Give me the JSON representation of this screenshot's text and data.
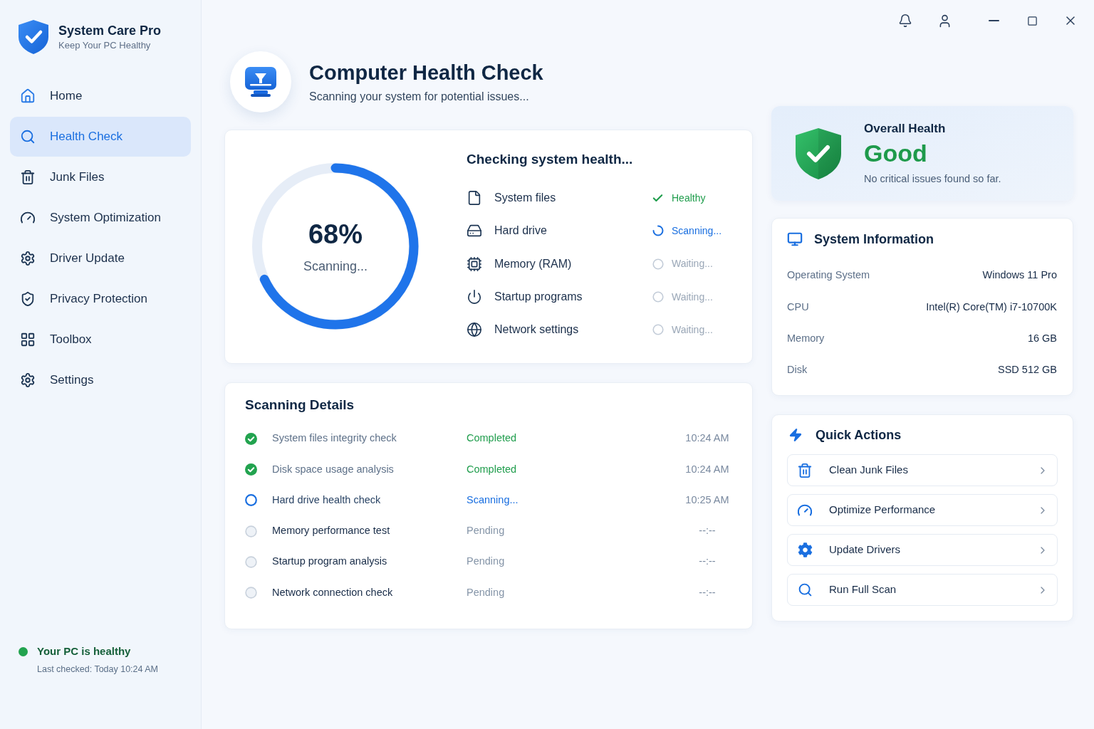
{
  "app": {
    "name": "System Care Pro",
    "tagline": "Keep Your PC Healthy"
  },
  "sidebar": {
    "items": [
      {
        "label": "Home",
        "selected": false
      },
      {
        "label": "Health Check",
        "selected": true
      },
      {
        "label": "Junk Files",
        "selected": false
      },
      {
        "label": "System Optimization",
        "selected": false
      },
      {
        "label": "Driver Update",
        "selected": false
      },
      {
        "label": "Privacy Protection",
        "selected": false
      },
      {
        "label": "Toolbox",
        "selected": false
      },
      {
        "label": "Settings",
        "selected": false
      }
    ],
    "status": {
      "title": "Your PC is healthy",
      "detail": "Last checked: Today 10:24 AM"
    }
  },
  "header": {
    "title": "Computer Health Check",
    "subtitle": "Scanning your system for potential issues..."
  },
  "scan_progress": {
    "level": 0.68,
    "percent": "68%",
    "label": "Scanning..."
  },
  "health_checks": {
    "title": "Checking system health...",
    "items": [
      {
        "label": "System files",
        "status": "Healthy",
        "kind": "done"
      },
      {
        "label": "Hard drive",
        "status": "Scanning...",
        "kind": "scanning"
      },
      {
        "label": "Memory (RAM)",
        "status": "Waiting...",
        "kind": "waiting"
      },
      {
        "label": "Startup programs",
        "status": "Waiting...",
        "kind": "waiting"
      },
      {
        "label": "Network settings",
        "status": "Waiting...",
        "kind": "waiting"
      }
    ]
  },
  "scanning_details": {
    "title": "Scanning Details",
    "rows": [
      {
        "task": "System files integrity check",
        "status": "Completed",
        "time": "10:24 AM",
        "kind": "done"
      },
      {
        "task": "Disk space usage analysis",
        "status": "Completed",
        "time": "10:24 AM",
        "kind": "done"
      },
      {
        "task": "Hard drive health check",
        "status": "Scanning...",
        "time": "10:25 AM",
        "kind": "scanning"
      },
      {
        "task": "Memory performance test",
        "status": "Pending",
        "time": "--:--",
        "kind": "pending"
      },
      {
        "task": "Startup program analysis",
        "status": "Pending",
        "time": "--:--",
        "kind": "pending"
      },
      {
        "task": "Network connection check",
        "status": "Pending",
        "time": "--:--",
        "kind": "pending"
      }
    ]
  },
  "overall_health": {
    "title": "Overall Health",
    "rating": "Good",
    "note": "No critical issues found so far."
  },
  "system_information": {
    "title": "System Information",
    "rows": [
      {
        "label": "Operating System",
        "value": "Windows 11 Pro"
      },
      {
        "label": "CPU",
        "value": "Intel(R) Core(TM) i7-10700K"
      },
      {
        "label": "Memory",
        "value": "16 GB"
      },
      {
        "label": "Disk",
        "value": "SSD 512 GB"
      }
    ]
  },
  "quick_actions": {
    "title": "Quick Actions",
    "items": [
      {
        "label": "Clean Junk Files"
      },
      {
        "label": "Optimize Performance"
      },
      {
        "label": "Update Drivers"
      },
      {
        "label": "Run Full Scan"
      }
    ]
  }
}
